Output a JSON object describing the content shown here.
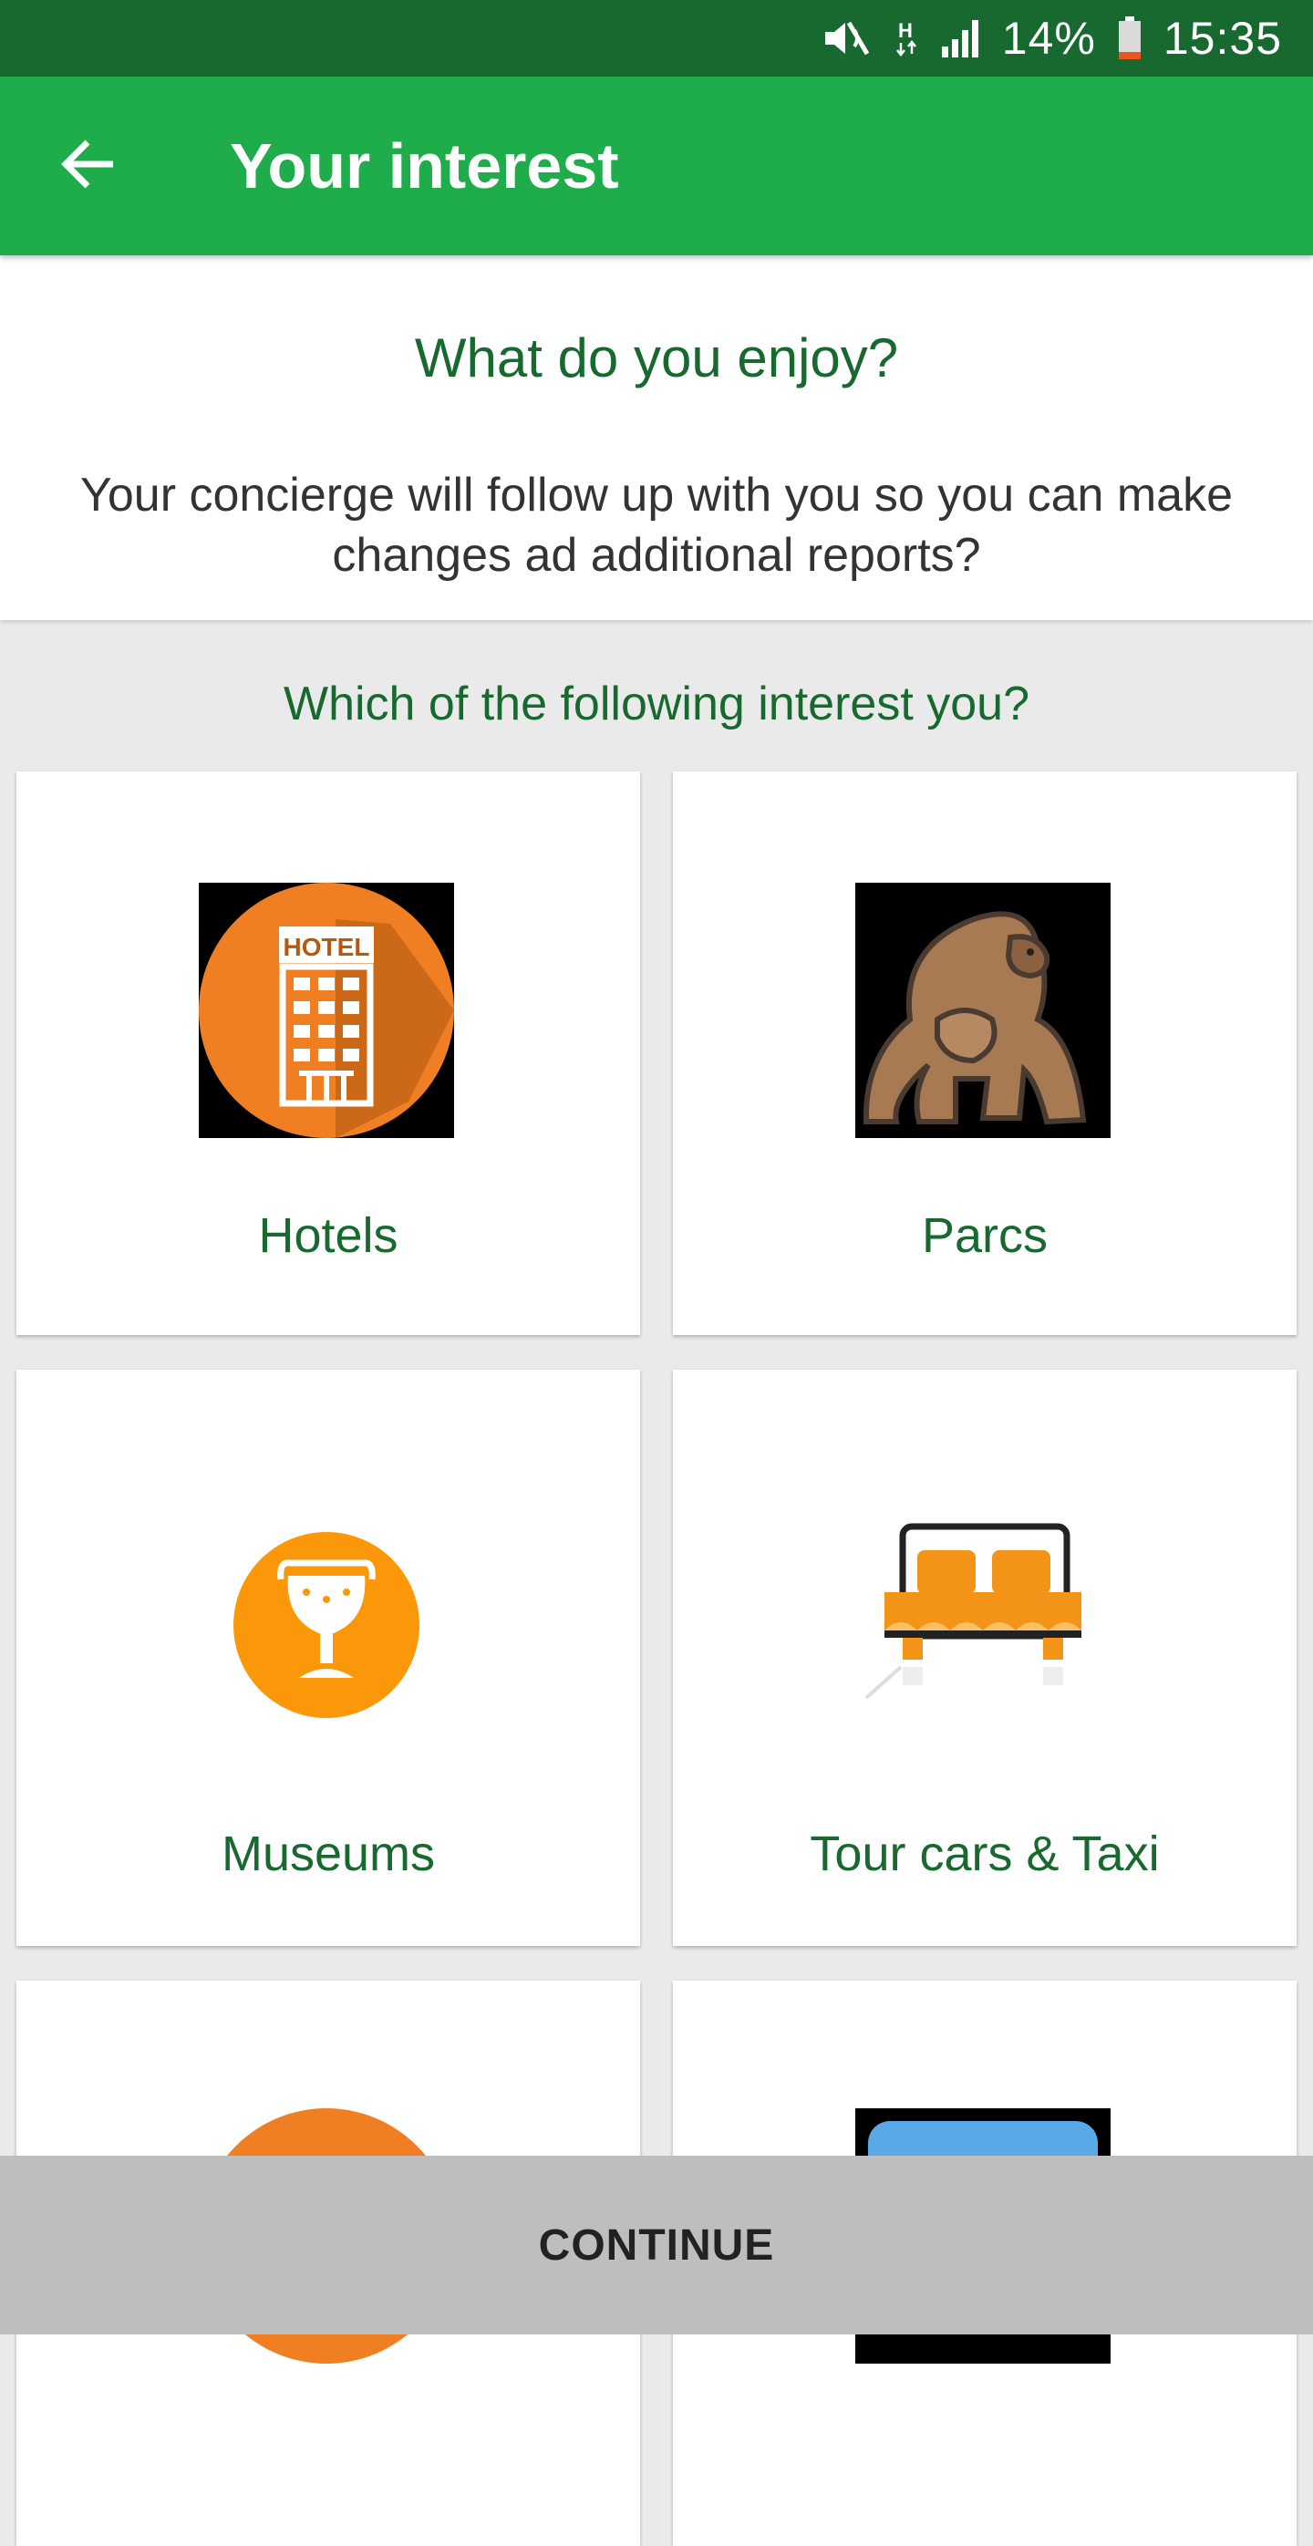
{
  "status_bar": {
    "battery": "14%",
    "time": "15:35",
    "icons": [
      "mute-icon",
      "network-h-icon",
      "signal-icon",
      "battery-icon"
    ]
  },
  "app_bar": {
    "title": "Your interest",
    "back_icon": "arrow-back-icon"
  },
  "intro": {
    "heading": "What do you enjoy?",
    "description": "Your concierge will follow up with you so you can make changes ad additional reports?"
  },
  "question": "Which of the following interest you?",
  "interests": [
    {
      "label": "Hotels",
      "icon": "hotel-icon"
    },
    {
      "label": "Parcs",
      "icon": "gorilla-icon"
    },
    {
      "label": "Museums",
      "icon": "trophy-icon"
    },
    {
      "label": "Tour cars & Taxi",
      "icon": "bed-icon"
    },
    {
      "label": "",
      "icon": "orange-circle-icon"
    },
    {
      "label": "",
      "icon": "blue-screen-icon"
    }
  ],
  "continue_label": "CONTINUE",
  "colors": {
    "status_bar": "#17692f",
    "app_bar": "#1fad4b",
    "accent_text": "#17692f",
    "continue_bg": "#bebebe"
  }
}
